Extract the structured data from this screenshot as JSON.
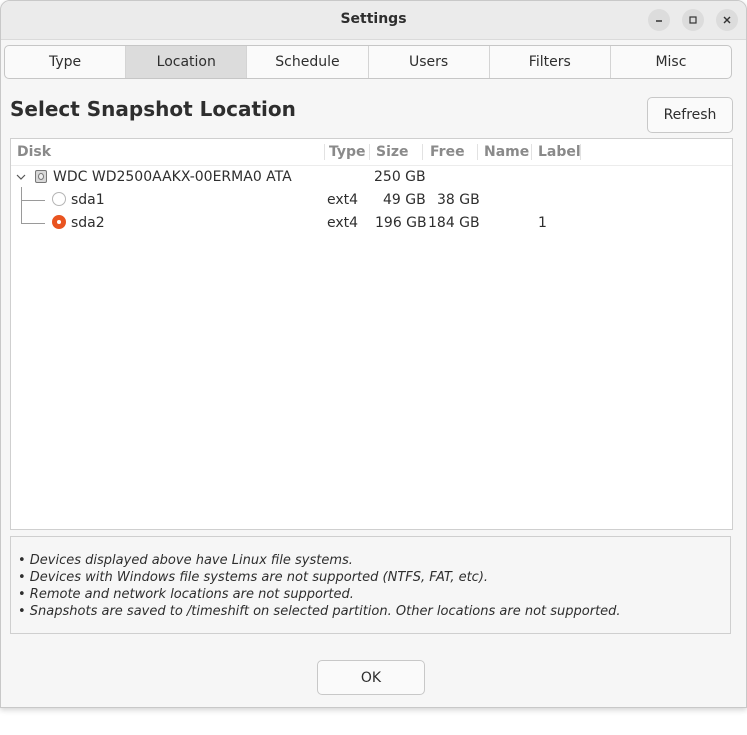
{
  "window": {
    "title": "Settings"
  },
  "tabs": [
    {
      "label": "Type"
    },
    {
      "label": "Location",
      "active": true
    },
    {
      "label": "Schedule"
    },
    {
      "label": "Users"
    },
    {
      "label": "Filters"
    },
    {
      "label": "Misc"
    }
  ],
  "heading": "Select Snapshot Location",
  "refresh_label": "Refresh",
  "columns": {
    "disk": "Disk",
    "type": "Type",
    "size": "Size",
    "free": "Free",
    "name": "Name",
    "label": "Label"
  },
  "disk": {
    "name": "WDC WD2500AAKX-00ERMA0 ATA",
    "size": "250 GB"
  },
  "partitions": [
    {
      "name": "sda1",
      "type": "ext4",
      "size": "49 GB",
      "free": "38 GB",
      "label_value": "",
      "selected": false
    },
    {
      "name": "sda2",
      "type": "ext4",
      "size": "196 GB",
      "free": "184 GB",
      "label_value": "1",
      "selected": true
    }
  ],
  "notes": [
    "• Devices displayed above have Linux file systems.",
    "• Devices with Windows file systems are not supported (NTFS, FAT, etc).",
    "• Remote and network locations are not supported.",
    "• Snapshots are saved to /timeshift on selected partition. Other locations are not supported."
  ],
  "ok_label": "OK",
  "colors": {
    "accent": "#e95420",
    "active_tab": "#dcdcdc"
  },
  "icons": {
    "minimize": "minimize-icon",
    "maximize": "maximize-icon",
    "close": "close-icon",
    "disk": "hard-disk-icon",
    "expander": "chevron-down-icon"
  }
}
